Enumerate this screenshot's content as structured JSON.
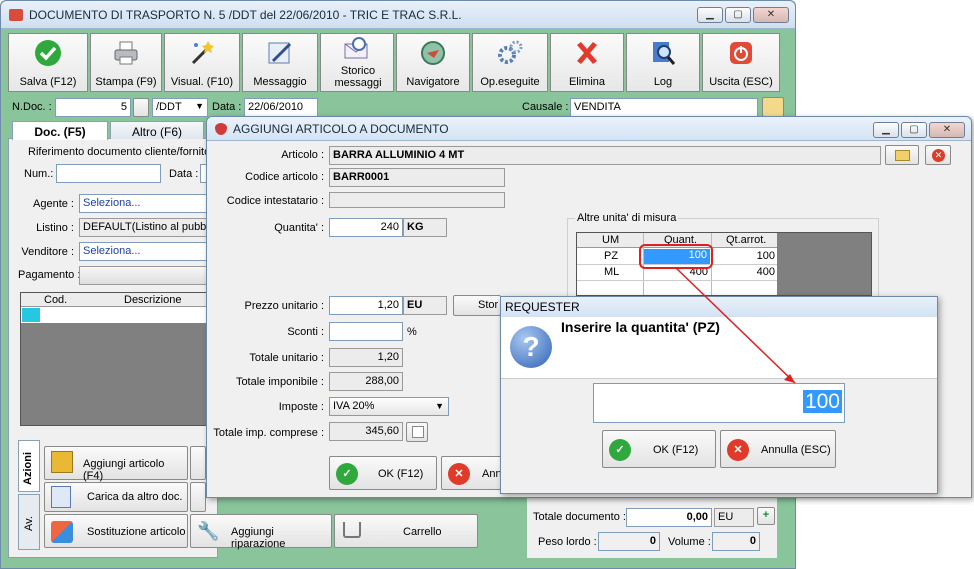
{
  "main": {
    "title": "DOCUMENTO DI TRASPORTO N. 5 /DDT del 22/06/2010 - TRIC E TRAC S.R.L.",
    "toolbar": [
      {
        "label": "Salva (F12)",
        "icon": "check-icon"
      },
      {
        "label": "Stampa (F9)",
        "icon": "printer-icon"
      },
      {
        "label": "Visual. (F10)",
        "icon": "wand-icon"
      },
      {
        "label": "Messaggio",
        "icon": "message-icon"
      },
      {
        "label": "Storico messaggi",
        "icon": "history-icon"
      },
      {
        "label": "Navigatore",
        "icon": "compass-icon"
      },
      {
        "label": "Op.eseguite",
        "icon": "gears-icon"
      },
      {
        "label": "Elimina",
        "icon": "delete-icon"
      },
      {
        "label": "Log",
        "icon": "magnifier-icon"
      },
      {
        "label": "Uscita (ESC)",
        "icon": "exit-icon"
      }
    ],
    "ndoc_label": "N.Doc. :",
    "ndoc_value": "5",
    "series": "/DDT",
    "data_label": "Data :",
    "data_value": "22/06/2010",
    "causale_label": "Causale :",
    "causale_value": "VENDITA",
    "tabs": [
      "Doc. (F5)",
      "Altro (F6)"
    ],
    "rif_label": "Riferimento documento cliente/fornito",
    "num_label": "Num.:",
    "data2_label": "Data :",
    "agente_label": "Agente :",
    "agente_value": "Seleziona...",
    "listino_label": "Listino :",
    "listino_value": "DEFAULT(Listino al pubbl",
    "venditore_label": "Venditore :",
    "venditore_value": "Seleziona...",
    "pagamento_label": "Pagamento :",
    "grid_headers": [
      "Cod.",
      "Descrizione"
    ],
    "side_tabs": [
      "Azioni",
      "Av."
    ],
    "actions": [
      "Aggiungi articolo (F4)",
      "Carica da altro doc.",
      "Sostituzione articolo",
      "Aggiungi riparazione",
      "Carrello"
    ],
    "totale_doc_label": "Totale documento :",
    "totale_doc_value": "0,00",
    "totale_doc_currency": "EU",
    "peso_label": "Peso lordo :",
    "peso_value": "0",
    "volume_label": "Volume :",
    "volume_value": "0"
  },
  "dialog": {
    "title": "AGGIUNGI ARTICOLO A DOCUMENTO",
    "articolo_label": "Articolo :",
    "articolo_value": "BARRA ALLUMINIO 4 MT",
    "codice_label": "Codice articolo :",
    "codice_value": "BARR0001",
    "intestatario_label": "Codice intestatario :",
    "quantita_label": "Quantita' :",
    "quantita_value": "240",
    "quantita_unit": "KG",
    "altre_um_label": "Altre unita' di misura",
    "um_headers": [
      "UM",
      "Quant.",
      "Qt.arrot."
    ],
    "um_rows": [
      {
        "um": "PZ",
        "quant": "100",
        "arrot": "100"
      },
      {
        "um": "ML",
        "quant": "400",
        "arrot": "400"
      }
    ],
    "prezzo_label": "Prezzo unitario :",
    "prezzo_value": "1,20",
    "prezzo_unit": "EU",
    "storico_partial": "Stor",
    "sconti_label": "Sconti :",
    "sconti_unit": "%",
    "totale_unitario_label": "Totale unitario :",
    "totale_unitario_value": "1,20",
    "imponibile_label": "Totale imponibile :",
    "imponibile_value": "288,00",
    "imposte_label": "Imposte :",
    "imposte_value": "IVA 20%",
    "totale_comp_label": "Totale imp. comprese :",
    "totale_comp_value": "345,60",
    "ok_label": "OK (F12)",
    "annulla_partial": "Ann"
  },
  "requester": {
    "title": "REQUESTER",
    "question": "Inserire la quantita' (PZ)",
    "value": "100",
    "ok_label": "OK (F12)",
    "cancel_label": "Annulla (ESC)"
  },
  "colors": {
    "accent_green": "#7cc58f",
    "highlight_red": "#e02020",
    "selection_blue": "#3399ff"
  }
}
